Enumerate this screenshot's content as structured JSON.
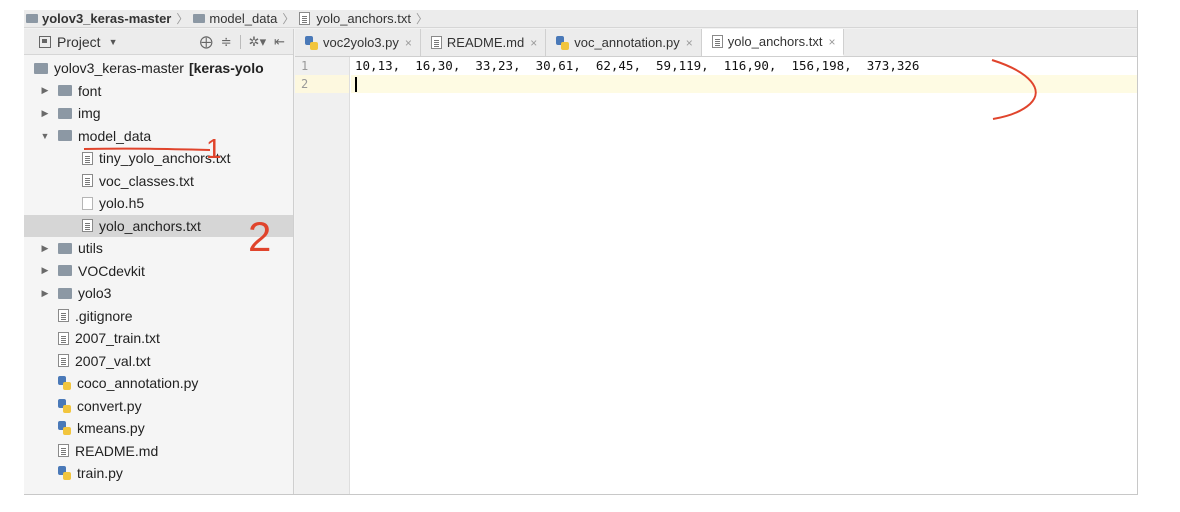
{
  "breadcrumb": {
    "items": [
      "yolov3_keras-master",
      "model_data",
      "yolo_anchors.txt"
    ]
  },
  "project_panel": {
    "title": "Project",
    "tree": [
      {
        "label": "yolov3_keras-master",
        "suffix": "[keras-yolo",
        "kind": "folder",
        "indent": 0,
        "arrow": ""
      },
      {
        "label": "font",
        "kind": "folder",
        "indent": 1,
        "arrow": "▶"
      },
      {
        "label": "img",
        "kind": "folder",
        "indent": 1,
        "arrow": "▶"
      },
      {
        "label": "model_data",
        "kind": "folder",
        "indent": 1,
        "arrow": "▼"
      },
      {
        "label": "tiny_yolo_anchors.txt",
        "kind": "text",
        "indent": 2,
        "arrow": ""
      },
      {
        "label": "voc_classes.txt",
        "kind": "text",
        "indent": 2,
        "arrow": ""
      },
      {
        "label": "yolo.h5",
        "kind": "blank",
        "indent": 2,
        "arrow": ""
      },
      {
        "label": "yolo_anchors.txt",
        "kind": "text",
        "indent": 2,
        "arrow": "",
        "selected": true
      },
      {
        "label": "utils",
        "kind": "folder",
        "indent": 1,
        "arrow": "▶"
      },
      {
        "label": "VOCdevkit",
        "kind": "folder",
        "indent": 1,
        "arrow": "▶"
      },
      {
        "label": "yolo3",
        "kind": "folder",
        "indent": 1,
        "arrow": "▶"
      },
      {
        "label": ".gitignore",
        "kind": "text",
        "indent": 1,
        "arrow": ""
      },
      {
        "label": "2007_train.txt",
        "kind": "text",
        "indent": 1,
        "arrow": ""
      },
      {
        "label": "2007_val.txt",
        "kind": "text",
        "indent": 1,
        "arrow": ""
      },
      {
        "label": "coco_annotation.py",
        "kind": "py",
        "indent": 1,
        "arrow": ""
      },
      {
        "label": "convert.py",
        "kind": "py",
        "indent": 1,
        "arrow": ""
      },
      {
        "label": "kmeans.py",
        "kind": "py",
        "indent": 1,
        "arrow": ""
      },
      {
        "label": "README.md",
        "kind": "text",
        "indent": 1,
        "arrow": ""
      },
      {
        "label": "train.py",
        "kind": "py",
        "indent": 1,
        "arrow": ""
      }
    ]
  },
  "tabs": [
    {
      "label": "voc2yolo3.py",
      "kind": "py",
      "active": false
    },
    {
      "label": "README.md",
      "kind": "text",
      "active": false
    },
    {
      "label": "voc_annotation.py",
      "kind": "py",
      "active": false
    },
    {
      "label": "yolo_anchors.txt",
      "kind": "text",
      "active": true
    }
  ],
  "editor": {
    "line_numbers": [
      "1",
      "2"
    ],
    "lines": [
      "10,13,  16,30,  33,23,  30,61,  62,45,  59,119,  116,90,  156,198,  373,326",
      ""
    ]
  },
  "annotations": {
    "marks": [
      "1",
      "2"
    ],
    "color": "#e0442c"
  }
}
